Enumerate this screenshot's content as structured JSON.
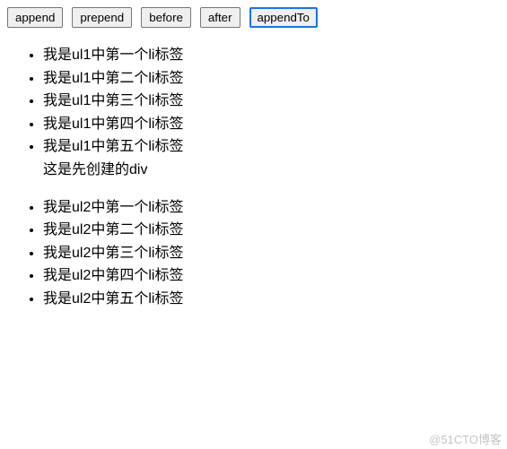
{
  "buttons": {
    "append": "append",
    "prepend": "prepend",
    "before": "before",
    "after": "after",
    "appendTo": "appendTo"
  },
  "ul1": {
    "items": [
      "我是ul1中第一个li标签",
      "我是ul1中第二个li标签",
      "我是ul1中第三个li标签",
      "我是ul1中第四个li标签",
      "我是ul1中第五个li标签"
    ]
  },
  "created_div": "这是先创建的div",
  "ul2": {
    "items": [
      "我是ul2中第一个li标签",
      "我是ul2中第二个li标签",
      "我是ul2中第三个li标签",
      "我是ul2中第四个li标签",
      "我是ul2中第五个li标签"
    ]
  },
  "watermark": "@51CTO博客"
}
